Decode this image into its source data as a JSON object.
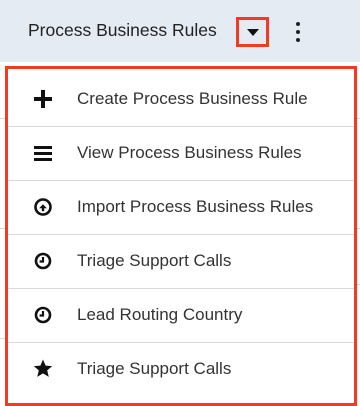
{
  "header": {
    "module_title": "Process Business Rules",
    "caret_icon": "caret-down-icon",
    "more_icon": "kebab-menu-icon"
  },
  "menu": {
    "items": [
      {
        "label": "Create Process Business Rule",
        "icon": "plus-icon"
      },
      {
        "label": "View Process Business Rules",
        "icon": "list-icon"
      },
      {
        "label": "Import Process Business Rules",
        "icon": "upload-circle-icon"
      },
      {
        "label": "Triage Support Calls",
        "icon": "clock-icon"
      },
      {
        "label": "Lead Routing Country",
        "icon": "clock-icon"
      },
      {
        "label": "Triage Support Calls",
        "icon": "star-icon"
      }
    ]
  },
  "colors": {
    "header_bg": "#e5ebf3",
    "highlight": "#f33b22",
    "text": "#333333"
  }
}
